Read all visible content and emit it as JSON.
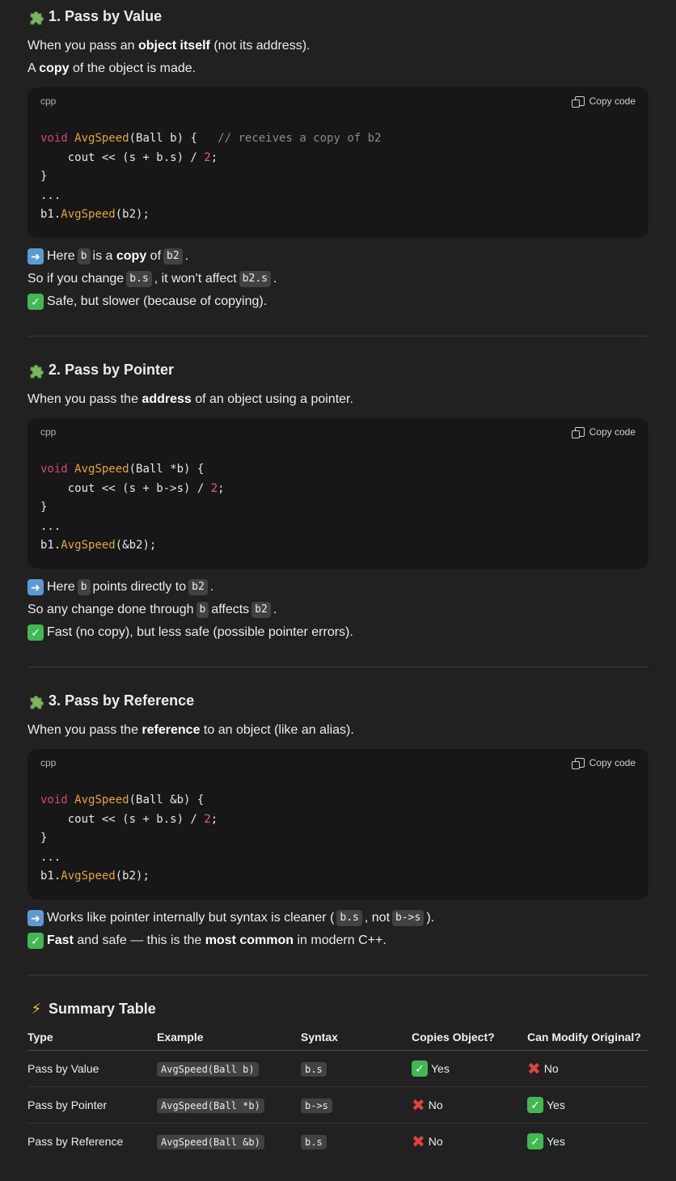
{
  "section1": {
    "title": "1. Pass by Value",
    "intro_pre": "When you pass an ",
    "intro_bold": "object itself",
    "intro_post": " (not its address).",
    "line2_pre": "A ",
    "line2_bold": "copy",
    "line2_post": " of the object is made.",
    "code_lang": "cpp",
    "copy_label": "Copy code",
    "note1": [
      "Here",
      "b",
      "is a",
      "copy",
      "of",
      "b2",
      "."
    ],
    "note2": [
      "So if you change",
      "b.s",
      ", it won’t affect",
      "b2.s",
      "."
    ],
    "note3": "Safe, but slower (because of copying)."
  },
  "section2": {
    "title": "2. Pass by Pointer",
    "intro_pre": "When you pass the ",
    "intro_bold": "address",
    "intro_post": " of an object using a pointer.",
    "code_lang": "cpp",
    "copy_label": "Copy code",
    "note1": [
      "Here",
      "b",
      "points directly to",
      "b2",
      "."
    ],
    "note2": [
      "So any change done through",
      "b",
      "affects",
      "b2",
      "."
    ],
    "note3": "Fast (no copy), but less safe (possible pointer errors)."
  },
  "section3": {
    "title": "3. Pass by Reference",
    "intro_pre": "When you pass the ",
    "intro_bold": "reference",
    "intro_post": " to an object (like an alias).",
    "code_lang": "cpp",
    "copy_label": "Copy code",
    "note1": [
      "Works like pointer internally but syntax is cleaner (",
      "b.s",
      ", not",
      "b->s",
      ")."
    ],
    "note2": [
      "Fast",
      "and",
      "safe — this is the",
      "most common",
      "in modern C++."
    ]
  },
  "summary": {
    "title": "Summary Table",
    "headers": [
      "Type",
      "Example",
      "Syntax",
      "Copies Object?",
      "Can Modify Original?"
    ],
    "rows": [
      {
        "type": "Pass by Value",
        "example": "AvgSpeed(Ball b)",
        "syntax": "b.s",
        "copies": "Yes",
        "copies_ok": true,
        "modify": "No",
        "modify_ok": false
      },
      {
        "type": "Pass by Pointer",
        "example": "AvgSpeed(Ball *b)",
        "syntax": "b->s",
        "copies": "No",
        "copies_ok": false,
        "modify": "Yes",
        "modify_ok": true
      },
      {
        "type": "Pass by Reference",
        "example": "AvgSpeed(Ball &b)",
        "syntax": "b.s",
        "copies": "No",
        "copies_ok": false,
        "modify": "Yes",
        "modify_ok": true
      }
    ]
  },
  "code1": {
    "l1_kw": "void",
    "l1_fn": "AvgSpeed",
    "l1_rest": "(Ball b) {   ",
    "l1_cm": "// receives a copy of b2",
    "l2_a": "    cout << (s + b.s) / ",
    "l2_num": "2",
    "l2_b": ";",
    "l3": "}",
    "l4": "...",
    "l5_a": "b1.",
    "l5_fn": "AvgSpeed",
    "l5_b": "(b2);"
  },
  "code2": {
    "l1_kw": "void",
    "l1_fn": "AvgSpeed",
    "l1_rest": "(Ball *b) {",
    "l2_a": "    cout << (s + b->s) / ",
    "l2_num": "2",
    "l2_b": ";",
    "l3": "}",
    "l4": "...",
    "l5_a": "b1.",
    "l5_fn": "AvgSpeed",
    "l5_b": "(&b2);"
  },
  "code3": {
    "l1_kw": "void",
    "l1_fn": "AvgSpeed",
    "l1_rest": "(Ball &b) {",
    "l2_a": "    cout << (s + b.s) / ",
    "l2_num": "2",
    "l2_b": ";",
    "l3": "}",
    "l4": "...",
    "l5_a": "b1.",
    "l5_fn": "AvgSpeed",
    "l5_b": "(b2);"
  },
  "icons": {
    "puzzle": "puzzle-icon",
    "arrow": "right-arrow-icon",
    "check": "check-mark-icon",
    "cross": "cross-mark-icon",
    "lightning": "lightning-icon"
  },
  "colors": {
    "background": "#212121",
    "code_bg": "#171717",
    "keyword": "#d9466f",
    "function": "#e5a53b",
    "check": "#3fb950",
    "cross": "#e5413a",
    "arrow": "#5b9bd5"
  }
}
